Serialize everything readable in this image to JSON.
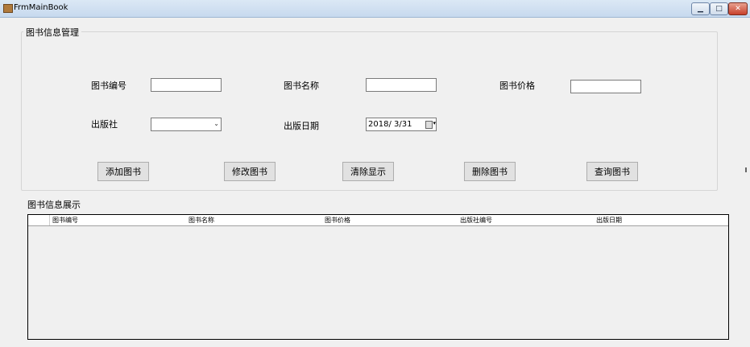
{
  "window": {
    "title": "FrmMainBook",
    "min_symbol": "▁",
    "max_symbol": "□",
    "close_symbol": "✕"
  },
  "group": {
    "title": "图书信息管理",
    "labels": {
      "book_id": "图书编号",
      "book_name": "图书名称",
      "book_price": "图书价格",
      "publisher": "出版社",
      "publish_date": "出版日期"
    },
    "fields": {
      "book_id_value": "",
      "book_name_value": "",
      "book_price_value": "",
      "publisher_value": "",
      "publish_date_value": "2018/ 3/31"
    }
  },
  "buttons": {
    "add": "添加图书",
    "modify": "修改图书",
    "clear": "清除显示",
    "delete": "删除图书",
    "query": "查询图书"
  },
  "grid": {
    "title": "图书信息展示",
    "columns": [
      "图书编号",
      "图书名称",
      "图书价格",
      "出版社编号",
      "出版日期"
    ],
    "rows": []
  }
}
